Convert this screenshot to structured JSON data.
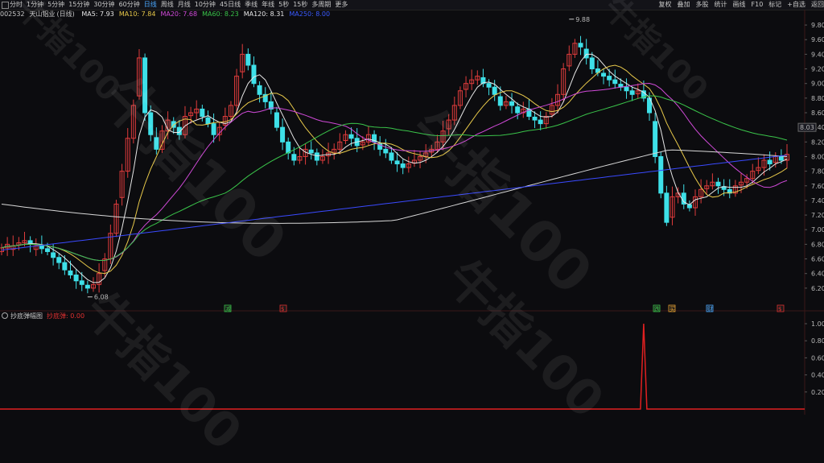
{
  "toolbar": {
    "periods": [
      "分时",
      "1分钟",
      "5分钟",
      "15分钟",
      "30分钟",
      "60分钟",
      "日线",
      "周线",
      "月线",
      "10分钟",
      "45日线",
      "季线",
      "年线",
      "5秒",
      "15秒",
      "多周期",
      "更多"
    ],
    "active_period": "日线",
    "tools": [
      "复权",
      "叠加",
      "多股",
      "统计",
      "画线",
      "F10",
      "标记",
      "+自选",
      "返回"
    ]
  },
  "main": {
    "stock_code": "002532",
    "stock_name": "天山铝业",
    "stock_period": "(日线)",
    "ma": [
      {
        "label": "MA5: 7.93",
        "color": "#e8e8e8"
      },
      {
        "label": "MA10: 7.84",
        "color": "#e8c94a"
      },
      {
        "label": "MA20: 7.68",
        "color": "#d04ad8"
      },
      {
        "label": "MA60: 8.23",
        "color": "#3ac44a"
      },
      {
        "label": "MA120: 8.31",
        "color": "#e8e8e8"
      },
      {
        "label": "MA250: 8.00",
        "color": "#3a5aff"
      }
    ],
    "price_ticks": [
      "9.80",
      "9.60",
      "9.40",
      "9.20",
      "9.00",
      "8.80",
      "8.60",
      "8.40",
      "8.20",
      "8.00",
      "7.80",
      "7.60",
      "7.40",
      "7.20",
      "7.00",
      "6.80",
      "6.60",
      "6.40",
      "6.20"
    ],
    "current_price": "8.03",
    "high_label": "9.88",
    "low_label": "6.08",
    "event_marks": [
      {
        "text": "减",
        "color": "#3ac44a"
      },
      {
        "text": "$",
        "color": "#e03030"
      },
      {
        "text": "跌",
        "color": "#3ac44a"
      },
      {
        "text": "买",
        "color": "#e8a030"
      },
      {
        "text": "财",
        "color": "#4aa8ff"
      },
      {
        "text": "$",
        "color": "#e03030"
      }
    ],
    "up_color": "#e03c3c",
    "down_color": "#3ee0e8"
  },
  "sub": {
    "indicator_name": "抄底弹幅图",
    "indicator_value": "抄底弹: 0.00",
    "ticks": [
      "1.00",
      "0.80",
      "0.60",
      "0.40",
      "0.20"
    ],
    "spike_value": 1.0
  },
  "watermark": {
    "text": "牛指100"
  }
}
